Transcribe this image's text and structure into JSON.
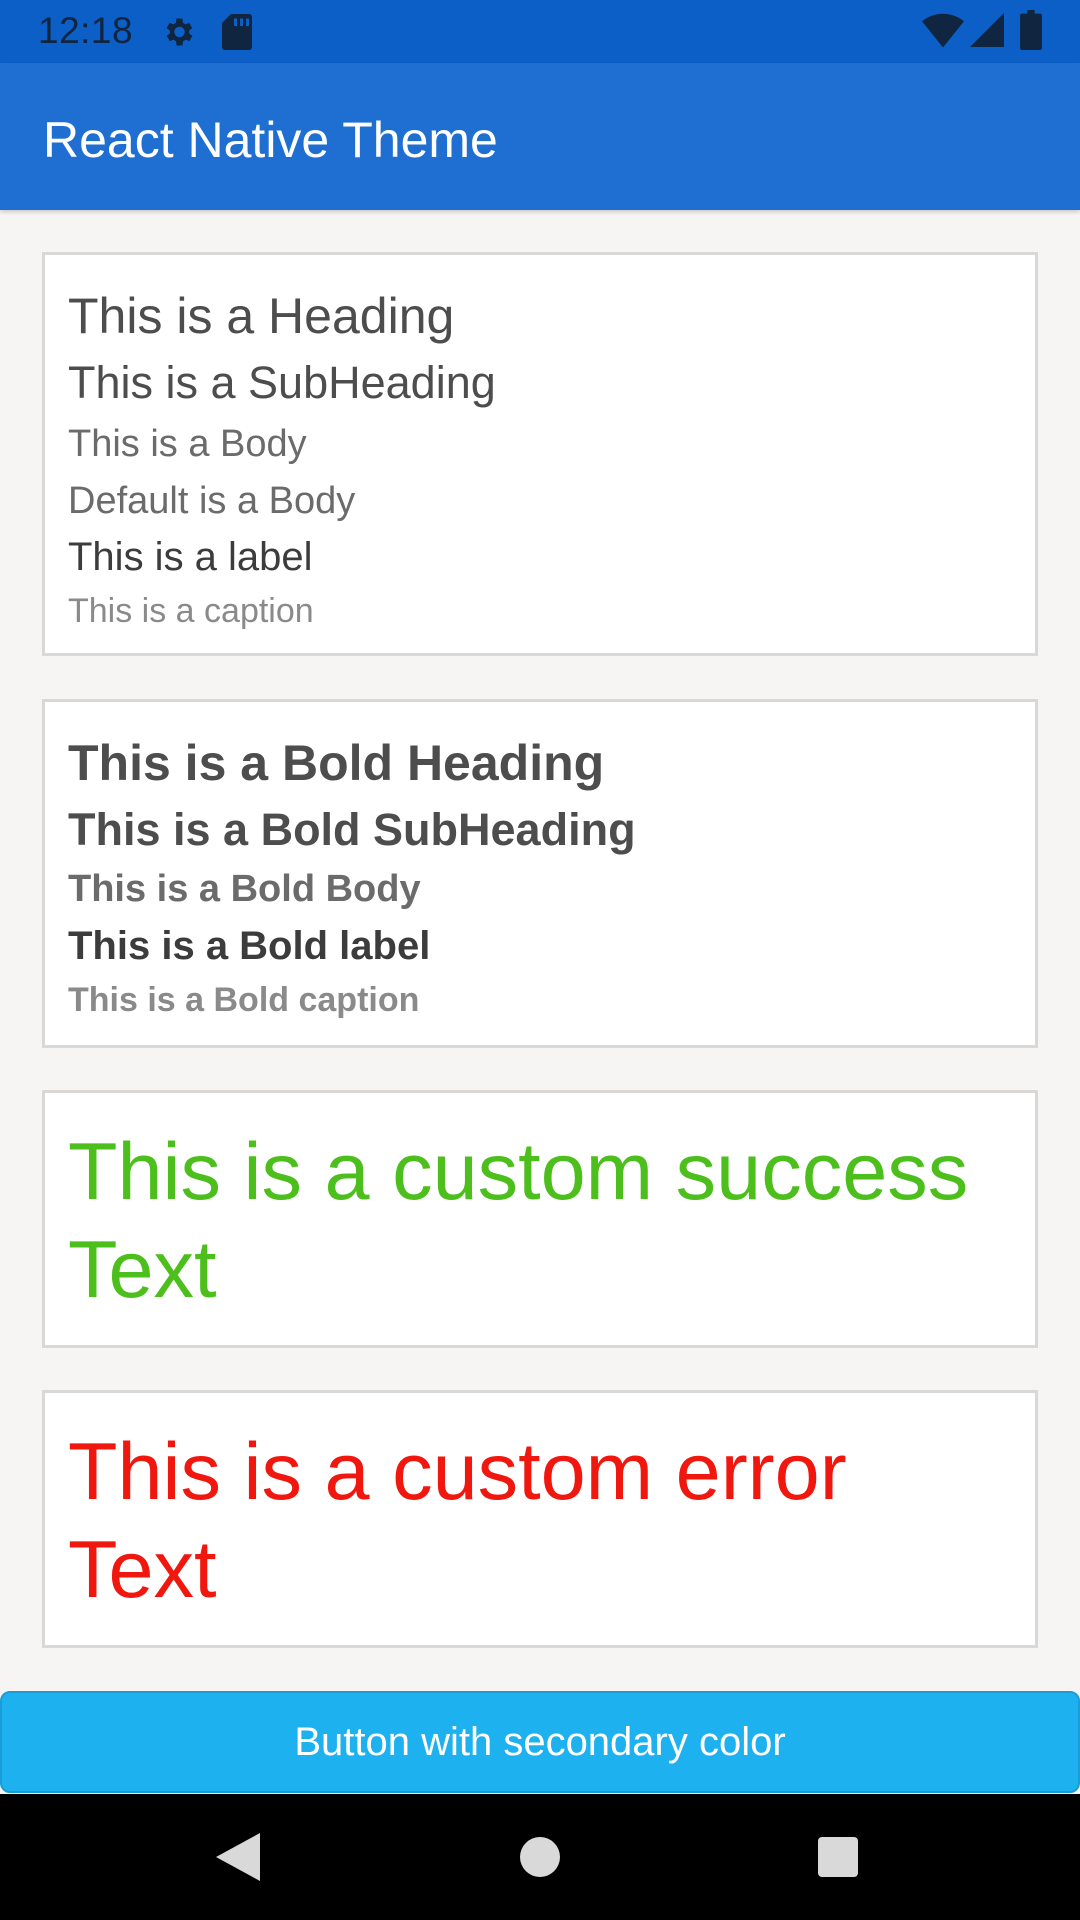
{
  "status_bar": {
    "time": "12:18",
    "icons": [
      "gear-icon",
      "sd-card-icon",
      "wifi-icon",
      "cell-signal-icon",
      "battery-icon"
    ]
  },
  "app_bar": {
    "title": "React Native Theme",
    "color": "#1e6fd1"
  },
  "typography_card": {
    "heading": "This is a Heading",
    "subheading": "This is a SubHeading",
    "body": "This is a Body",
    "default_body": "Default is a Body",
    "label": "This is a label",
    "caption": "This is a caption"
  },
  "bold_card": {
    "heading": "This is a Bold Heading",
    "subheading": "This is a Bold SubHeading",
    "body": "This is a Bold Body",
    "label": "This is a Bold label",
    "caption": "This is a Bold caption"
  },
  "success_card": {
    "text": "This is a custom success Text",
    "color": "#4cbf1c"
  },
  "error_card": {
    "text": "This is a custom error Text",
    "color": "#f0170f"
  },
  "secondary_button": {
    "label": "Button with secondary color",
    "color": "#1eb1ef"
  },
  "nav_bar": {
    "icons": [
      "back-icon",
      "home-icon",
      "recents-icon"
    ]
  }
}
